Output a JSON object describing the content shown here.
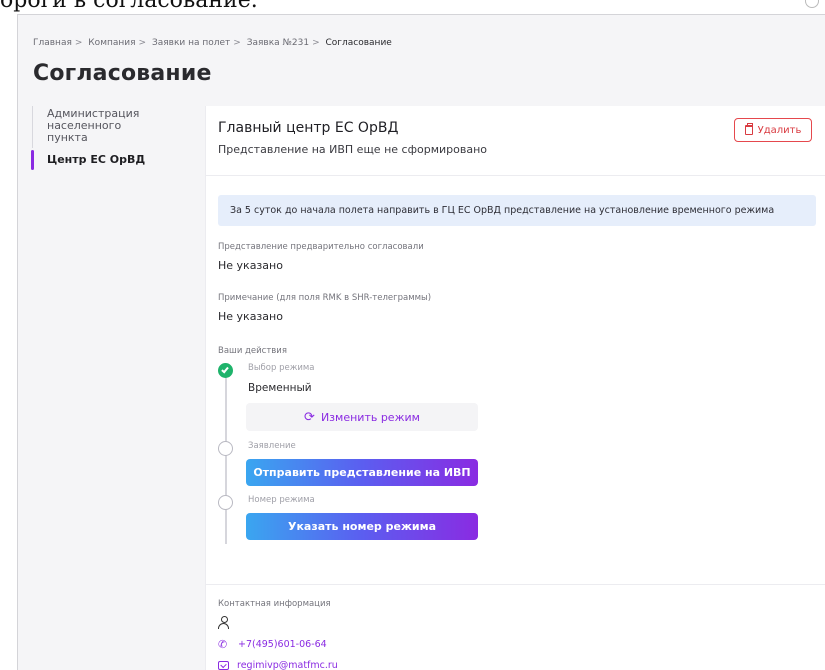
{
  "caption": {
    "text": "ороги в согласование."
  },
  "breadcrumb": {
    "items": [
      "Главная",
      "Компания",
      "Заявки на полет",
      "Заявка №231"
    ],
    "current": "Согласование",
    "separator": ">"
  },
  "page": {
    "title": "Согласование"
  },
  "sidebar": {
    "items": [
      {
        "label": "Администрация населенного пункта",
        "active": false
      },
      {
        "label": "Центр ЕС ОрВД",
        "active": true
      }
    ]
  },
  "card": {
    "title": "Главный центр ЕС ОрВД",
    "subtitle": "Представление на ИВП еще не сформировано",
    "delete_label": "Удалить",
    "banner": "За 5 суток до начала полета направить в ГЦ ЕС ОрВД представление на установление временного режима",
    "fields": {
      "pre_agreed": {
        "label": "Представление предварительно согласовали",
        "value": "Не указано"
      },
      "note": {
        "label": "Примечание (для поля RMK в SHR-телеграммы)",
        "value": "Не указано"
      }
    },
    "actions": {
      "label": "Ваши действия",
      "steps": {
        "mode": {
          "label": "Выбор режима",
          "value": "Временный",
          "button": "Изменить режим",
          "done": true
        },
        "statement": {
          "label": "Заявление",
          "button": "Отправить представление на ИВП",
          "done": false
        },
        "number": {
          "label": "Номер режима",
          "button": "Указать номер режима",
          "done": false
        }
      }
    },
    "contacts": {
      "label": "Контактная информация",
      "phone": "+7(495)601-06-64",
      "email": "regimivp@matfmc.ru"
    }
  },
  "colors": {
    "accent": "#8a2be2",
    "danger": "#e5484d",
    "success": "#1fb36b",
    "banner_bg": "#e6eefb",
    "gradient_start": "#3aa6f0",
    "gradient_end": "#8a2be2"
  },
  "icons": {
    "delete": "trash-icon",
    "change_mode": "refresh-icon",
    "done_step": "check-icon",
    "contact_person": "person-icon",
    "phone": "phone-icon",
    "email": "mail-icon"
  }
}
